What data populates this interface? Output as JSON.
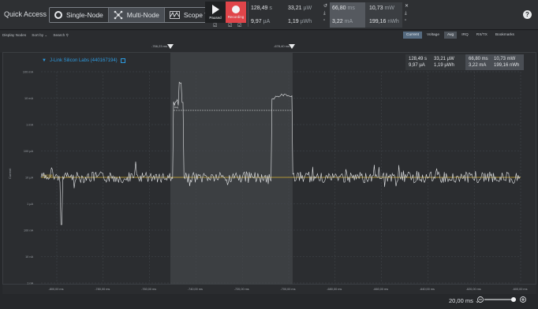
{
  "toolbar": {
    "quick_access": "Quick Access",
    "modes": [
      "Single-Node",
      "Multi-Node",
      "Scope View"
    ],
    "active_mode": 1,
    "paused_label": "Paused",
    "recording_label": "Recording",
    "measurements": {
      "a1": "128,49",
      "a1u": "s",
      "a2": "33,21",
      "a2u": "µW",
      "b1": "9,97",
      "b1u": "µA",
      "b2": "1,19",
      "b2u": "µWh",
      "c1": "66,80",
      "c1u": "ms",
      "c2": "10,73",
      "c2u": "mW",
      "d1": "3,22",
      "d1u": "mA",
      "d2": "199,16",
      "d2u": "nWh"
    },
    "help_label": "?"
  },
  "subbar": {
    "display_nodes": "Display Nodes",
    "sort_by": "Sort by",
    "search": "Search",
    "tabs": [
      "Current",
      "Voltage",
      "Avg",
      "IRQ",
      "RX/TX",
      "Bookmarks"
    ],
    "active_tab": "Current",
    "active_tab2": "Avg"
  },
  "timeline": {
    "marker_left": "-766,23 ms",
    "marker_right": "-678,40 ms"
  },
  "chart": {
    "node_label": "J-Link Silicon Labs (440167194)",
    "y_axis_label": "Current",
    "y_ticks": [
      "100 mA",
      "10 mA",
      "1 mA",
      "100 µA",
      "10 µA",
      "1 µA",
      "100 nA",
      "10 nA",
      "1 nA"
    ],
    "x_ticks": [
      "-800,00 ms",
      "-780,00 ms",
      "-760,00 ms",
      "-740,00 ms",
      "-720,00 ms",
      "-700,00 ms",
      "-680,00 ms",
      "-660,00 ms",
      "-640,00 ms",
      "-620,00 ms",
      "-600,00 ms"
    ],
    "average_label": "Average",
    "avg_marker_label": "Avg",
    "selection_panel": {
      "a1": "128,49 s",
      "a2": "33,21 µW",
      "b1": "9,97 µA",
      "b2": "1,19 µWh",
      "c1": "66,80 ms",
      "c2": "10,73 mW",
      "d1": "3,22 mA",
      "d2": "199,16 nWh"
    },
    "colors": {
      "trace": "#e6e8ea",
      "average": "#d7b233",
      "accent": "#2d9be0"
    }
  },
  "bottombar": {
    "zoom": "20,00 ms"
  }
}
